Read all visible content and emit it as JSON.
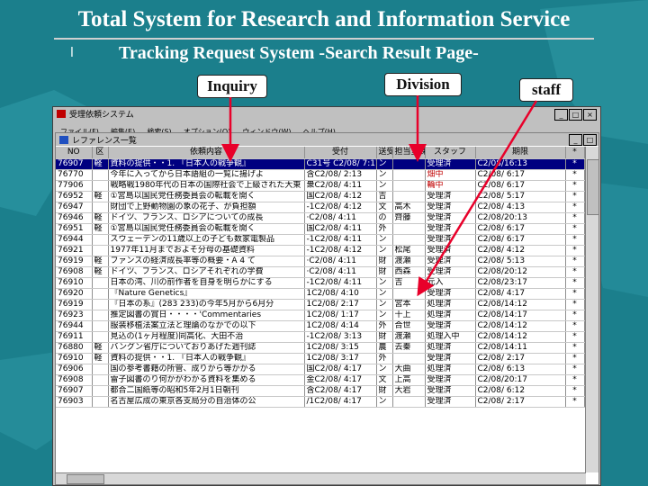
{
  "slide": {
    "title": "Total System for Research and Information Service",
    "bullet": "l",
    "subtitle": "Tracking Request System -Search Result Page-",
    "callouts": {
      "inquiry": "Inquiry",
      "division": "Division",
      "staff": "staff"
    }
  },
  "colors": {
    "background": "#1b7f8c",
    "selection": "#000080",
    "callout_arrow": "#e8002a"
  },
  "window": {
    "title": "受理依頼システム",
    "menu": [
      "ファイル(F)",
      "編集(E)",
      "検索(S)",
      "オプション(O)",
      "ウィンドウ(W)",
      "ヘルプ(H)"
    ],
    "buttons": [
      "_",
      "□",
      "×"
    ],
    "inner_title": "レファレンス一覧",
    "inner_buttons": [
      "_",
      "□"
    ]
  },
  "table": {
    "columns": [
      "NO",
      "区",
      "依頼内容",
      "受付",
      "送受",
      "担当室課",
      "スタッフ",
      "期限",
      "*"
    ],
    "rows": [
      [
        "76907",
        "軽",
        "資料の提供・・1. 『日本人の戦争観』",
        "C31号 C2/08/ 7:17",
        "ン",
        "",
        "受理済",
        "C2/08/16:13",
        "*"
      ],
      [
        "76770",
        "",
        "今年に入ってから日本語組の一覧に揚げよ",
        "含C2/08/ 2:13",
        "ン",
        "",
        "畑中",
        "C2/08/ 6:17",
        "*"
      ],
      [
        "77906",
        "",
        "戦略戦1980年代の日本の国際社会で上級された大東",
        "衆C2/08/ 4:11",
        "ン",
        "",
        "輪中",
        "C2/08/ 6:17",
        "*"
      ],
      [
        "76952",
        "軽",
        "①宮島以国民党任務委員会の転載を開く",
        "国C2/08/ 4:12",
        "吉",
        "",
        "受理済",
        "C2/08/ 5:17",
        "*"
      ],
      [
        "76947",
        "",
        "財団で上野動物園の象の花子、が負担額",
        "-1C2/08/ 4:12",
        "文",
        "高木",
        "受理済",
        "C2/08/ 4:13",
        "*"
      ],
      [
        "76946",
        "軽",
        "ドイツ、フランス、ロシアについての成長",
        "·C2/08/ 4:11",
        "の",
        "齊藤",
        "受理済",
        "C2/08/20:13",
        "*"
      ],
      [
        "76951",
        "軽",
        "①宮島以国民党任務委員会の転載を開く",
        "国C2/08/ 4:11",
        "外",
        "",
        "受理済",
        "C2/08/ 6:17",
        "*"
      ],
      [
        "76944",
        "",
        "スウェーデンの11歳以上の子ども数家電製品",
        "-1C2/08/ 4:11",
        "ン",
        "",
        "受理済",
        "C2/08/ 6:17",
        "*"
      ],
      [
        "76921",
        "",
        "1977年11月までおよそ分母の基礎資料",
        "-1C2/08/ 4:12",
        "ン",
        "松尾",
        "受理済",
        "C2/08/ 4:12",
        "*"
      ],
      [
        "76919",
        "軽",
        "ファンスの経済成長率等の概要・A 4 て",
        "·C2/08/ 4:11",
        "財",
        "渡瀬",
        "受理済",
        "C2/08/ 5:13",
        "*"
      ],
      [
        "76908",
        "軽",
        "ドイツ、フランス、ロシアそれぞれの学費",
        "·C2/08/ 4:11",
        "財",
        "西森",
        "受理済",
        "C2/08/20:12",
        "*"
      ],
      [
        "76910",
        "",
        "日本の湾、川の前作者を自身を明らかにする",
        "-1C2/08/ 4:11",
        "ン",
        "吉",
        "元入",
        "C2/08/23:17",
        "*"
      ],
      [
        "76920",
        "",
        "『Nature Genetics』",
        "1C2/08/ 4:10",
        "ン",
        "",
        "受理済",
        "C2/08/ 4:17",
        "*"
      ],
      [
        "76919",
        "",
        "『日本の系』(283 233)の今年5月から6月分",
        "1C2/08/ 2:17",
        "ン",
        "宮本",
        "処理済",
        "C2/08/14:12",
        "*"
      ],
      [
        "76923",
        "",
        "推定図書の賞日・・・・'Commentaries",
        "1C2/08/ 1:17",
        "ン",
        "十上",
        "処理済",
        "C2/08/14:17",
        "*"
      ],
      [
        "76944",
        "",
        "服装移植法案立法と理論のなかでの以下",
        "1C2/08/ 4:14",
        "外",
        "合世",
        "受理済",
        "C2/08/14:12",
        "*"
      ],
      [
        "76911",
        "",
        "見込の(1ヶ月程度)同高化、大田不治",
        "-1C2/08/ 3:13",
        "財",
        "渡瀬",
        "処理入中",
        "C2/08/14:12",
        "*"
      ],
      [
        "76880",
        "軽",
        "バングン省庁についておりあげた週刊誌",
        "1C2/08/ 3:15",
        "農",
        "去秦",
        "処理済",
        "C2/08/14:11",
        "*"
      ],
      [
        "76910",
        "軽",
        "資料の提供・・1. 『日本人の戦争観』",
        "1C2/08/ 3:17",
        "外",
        "",
        "受理済",
        "C2/08/ 2:17",
        "*"
      ],
      [
        "76906",
        "",
        "国の参考書籍の所管、成りから等かかる",
        "国C2/08/ 4:17",
        "ン",
        "大曲",
        "処理済",
        "C2/08/ 6:13",
        "*"
      ],
      [
        "76908",
        "",
        "雷子図書のり何かがわかる資料を集める",
        "金C2/08/ 4:17",
        "文",
        "上高",
        "受理済",
        "C2/08/20:17",
        "*"
      ],
      [
        "76907",
        "",
        "都合二国紙等の昭和5年2月1日朝刊",
        "含C2/08/ 4:17",
        "財",
        "大岩",
        "受理済",
        "C2/08/ 6:12",
        "*"
      ],
      [
        "76903",
        "",
        "名古屋広成の東京各支局分の自治体の公",
        "/1C2/08/ 4:17",
        "ン",
        "",
        "受理済",
        "C2/08/ 2:17",
        "*"
      ]
    ]
  }
}
